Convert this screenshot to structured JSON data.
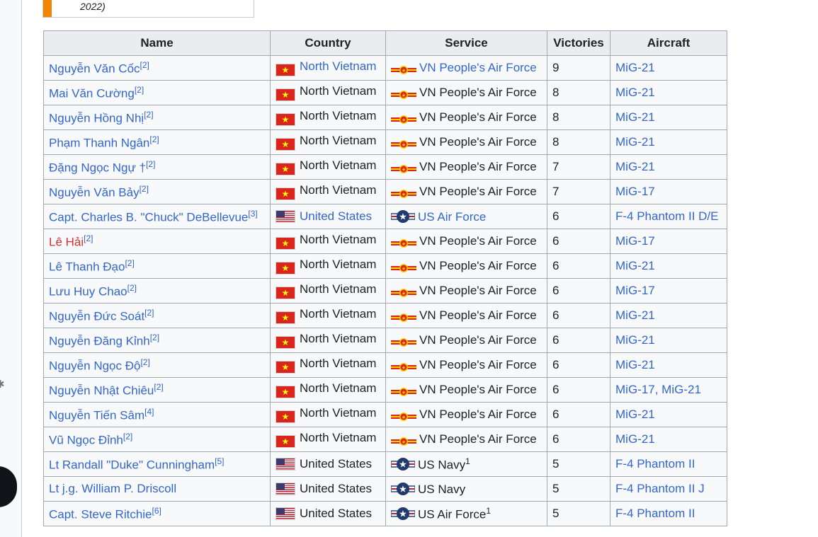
{
  "caption": {
    "text": "2022)"
  },
  "table": {
    "headers": {
      "name": "Name",
      "country": "Country",
      "service": "Service",
      "victories": "Victories",
      "aircraft": "Aircraft"
    },
    "rows": [
      {
        "name": "Nguyễn Văn Cốc",
        "ref": "[2]",
        "country": "North Vietnam",
        "service": "VN People's Air Force",
        "victories": "9",
        "aircraft": "MiG-21"
      },
      {
        "name": "Mai Văn Cường",
        "ref": "[2]",
        "country": "North Vietnam",
        "service": "VN People's Air Force",
        "victories": "8",
        "aircraft": "MiG-21"
      },
      {
        "name": "Nguyễn Hồng Nhị",
        "ref": "[2]",
        "country": "North Vietnam",
        "service": "VN People's Air Force",
        "victories": "8",
        "aircraft": "MiG-21"
      },
      {
        "name": "Phạm Thanh Ngân",
        "ref": "[2]",
        "country": "North Vietnam",
        "service": "VN People's Air Force",
        "victories": "8",
        "aircraft": "MiG-21"
      },
      {
        "name": "Đặng Ngọc Ngự †",
        "ref": "[2]",
        "country": "North Vietnam",
        "service": "VN People's Air Force",
        "victories": "7",
        "aircraft": "MiG-21"
      },
      {
        "name": "Nguyễn Văn Bảy",
        "ref": "[2]",
        "country": "North Vietnam",
        "service": "VN People's Air Force",
        "victories": "7",
        "aircraft": "MiG-17"
      },
      {
        "name": "Capt. Charles B. \"Chuck\" DeBellevue",
        "ref": "[3]",
        "country": "United States",
        "service": "US Air Force",
        "victories": "6",
        "aircraft": "F-4 Phantom II D/E"
      },
      {
        "name": "Lê Hải",
        "ref": "[2]",
        "country": "North Vietnam",
        "service": "VN People's Air Force",
        "victories": "6",
        "aircraft": "MiG-17"
      },
      {
        "name": "Lê Thanh Đạo",
        "ref": "[2]",
        "country": "North Vietnam",
        "service": "VN People's Air Force",
        "victories": "6",
        "aircraft": "MiG-21"
      },
      {
        "name": "Lưu Huy Chao",
        "ref": "[2]",
        "country": "North Vietnam",
        "service": "VN People's Air Force",
        "victories": "6",
        "aircraft": "MiG-17"
      },
      {
        "name": "Nguyễn Đức Soát",
        "ref": "[2]",
        "country": "North Vietnam",
        "service": "VN People's Air Force",
        "victories": "6",
        "aircraft": "MiG-21"
      },
      {
        "name": "Nguyễn Đăng Kỉnh",
        "ref": "[2]",
        "country": "North Vietnam",
        "service": "VN People's Air Force",
        "victories": "6",
        "aircraft": "MiG-21"
      },
      {
        "name": "Nguyễn Ngọc Độ",
        "ref": "[2]",
        "country": "North Vietnam",
        "service": "VN People's Air Force",
        "victories": "6",
        "aircraft": "MiG-21"
      },
      {
        "name": "Nguyễn Nhật Chiêu",
        "ref": "[2]",
        "country": "North Vietnam",
        "service": "VN People's Air Force",
        "victories": "6",
        "aircraft": "MiG-17, MiG-21"
      },
      {
        "name": "Nguyễn Tiến Sâm",
        "ref": "[4]",
        "country": "North Vietnam",
        "service": "VN People's Air Force",
        "victories": "6",
        "aircraft": "MiG-21"
      },
      {
        "name": "Vũ Ngọc Đỉnh",
        "ref": "[2]",
        "country": "North Vietnam",
        "service": "VN People's Air Force",
        "victories": "6",
        "aircraft": "MiG-21"
      },
      {
        "name": "Lt Randall \"Duke\" Cunningham",
        "ref": "[5]",
        "country": "United States",
        "service": "US Navy",
        "service_note": "1",
        "victories": "5",
        "aircraft": "F-4 Phantom II"
      },
      {
        "name": "Lt j.g. William P. Driscoll",
        "ref": "",
        "country": "United States",
        "service": "US Navy",
        "victories": "5",
        "aircraft": "F-4 Phantom II J"
      },
      {
        "name": "Capt. Steve Ritchie",
        "ref": "[6]",
        "country": "United States",
        "service": "US Air Force",
        "service_note": "1",
        "victories": "5",
        "aircraft": "F-4 Phantom II"
      }
    ]
  },
  "row_styles": {
    "missing_link_rows": [
      7
    ],
    "country_link_rows": [
      0,
      6
    ],
    "service_link_rows": [
      0,
      6
    ]
  },
  "icons": {
    "vn_flag": "vietnam-flag-icon",
    "us_flag": "us-flag-icon",
    "vn_roundel": "vpaf-roundel-icon",
    "us_roundel": "usaf-roundel-icon"
  },
  "colors": {
    "link": "#3366cc",
    "missing_link": "#d73333",
    "header_bg": "#eaecf0",
    "cell_bg": "#f8f9fa",
    "border": "#a2a9b1",
    "caption_accent": "#f28500"
  }
}
